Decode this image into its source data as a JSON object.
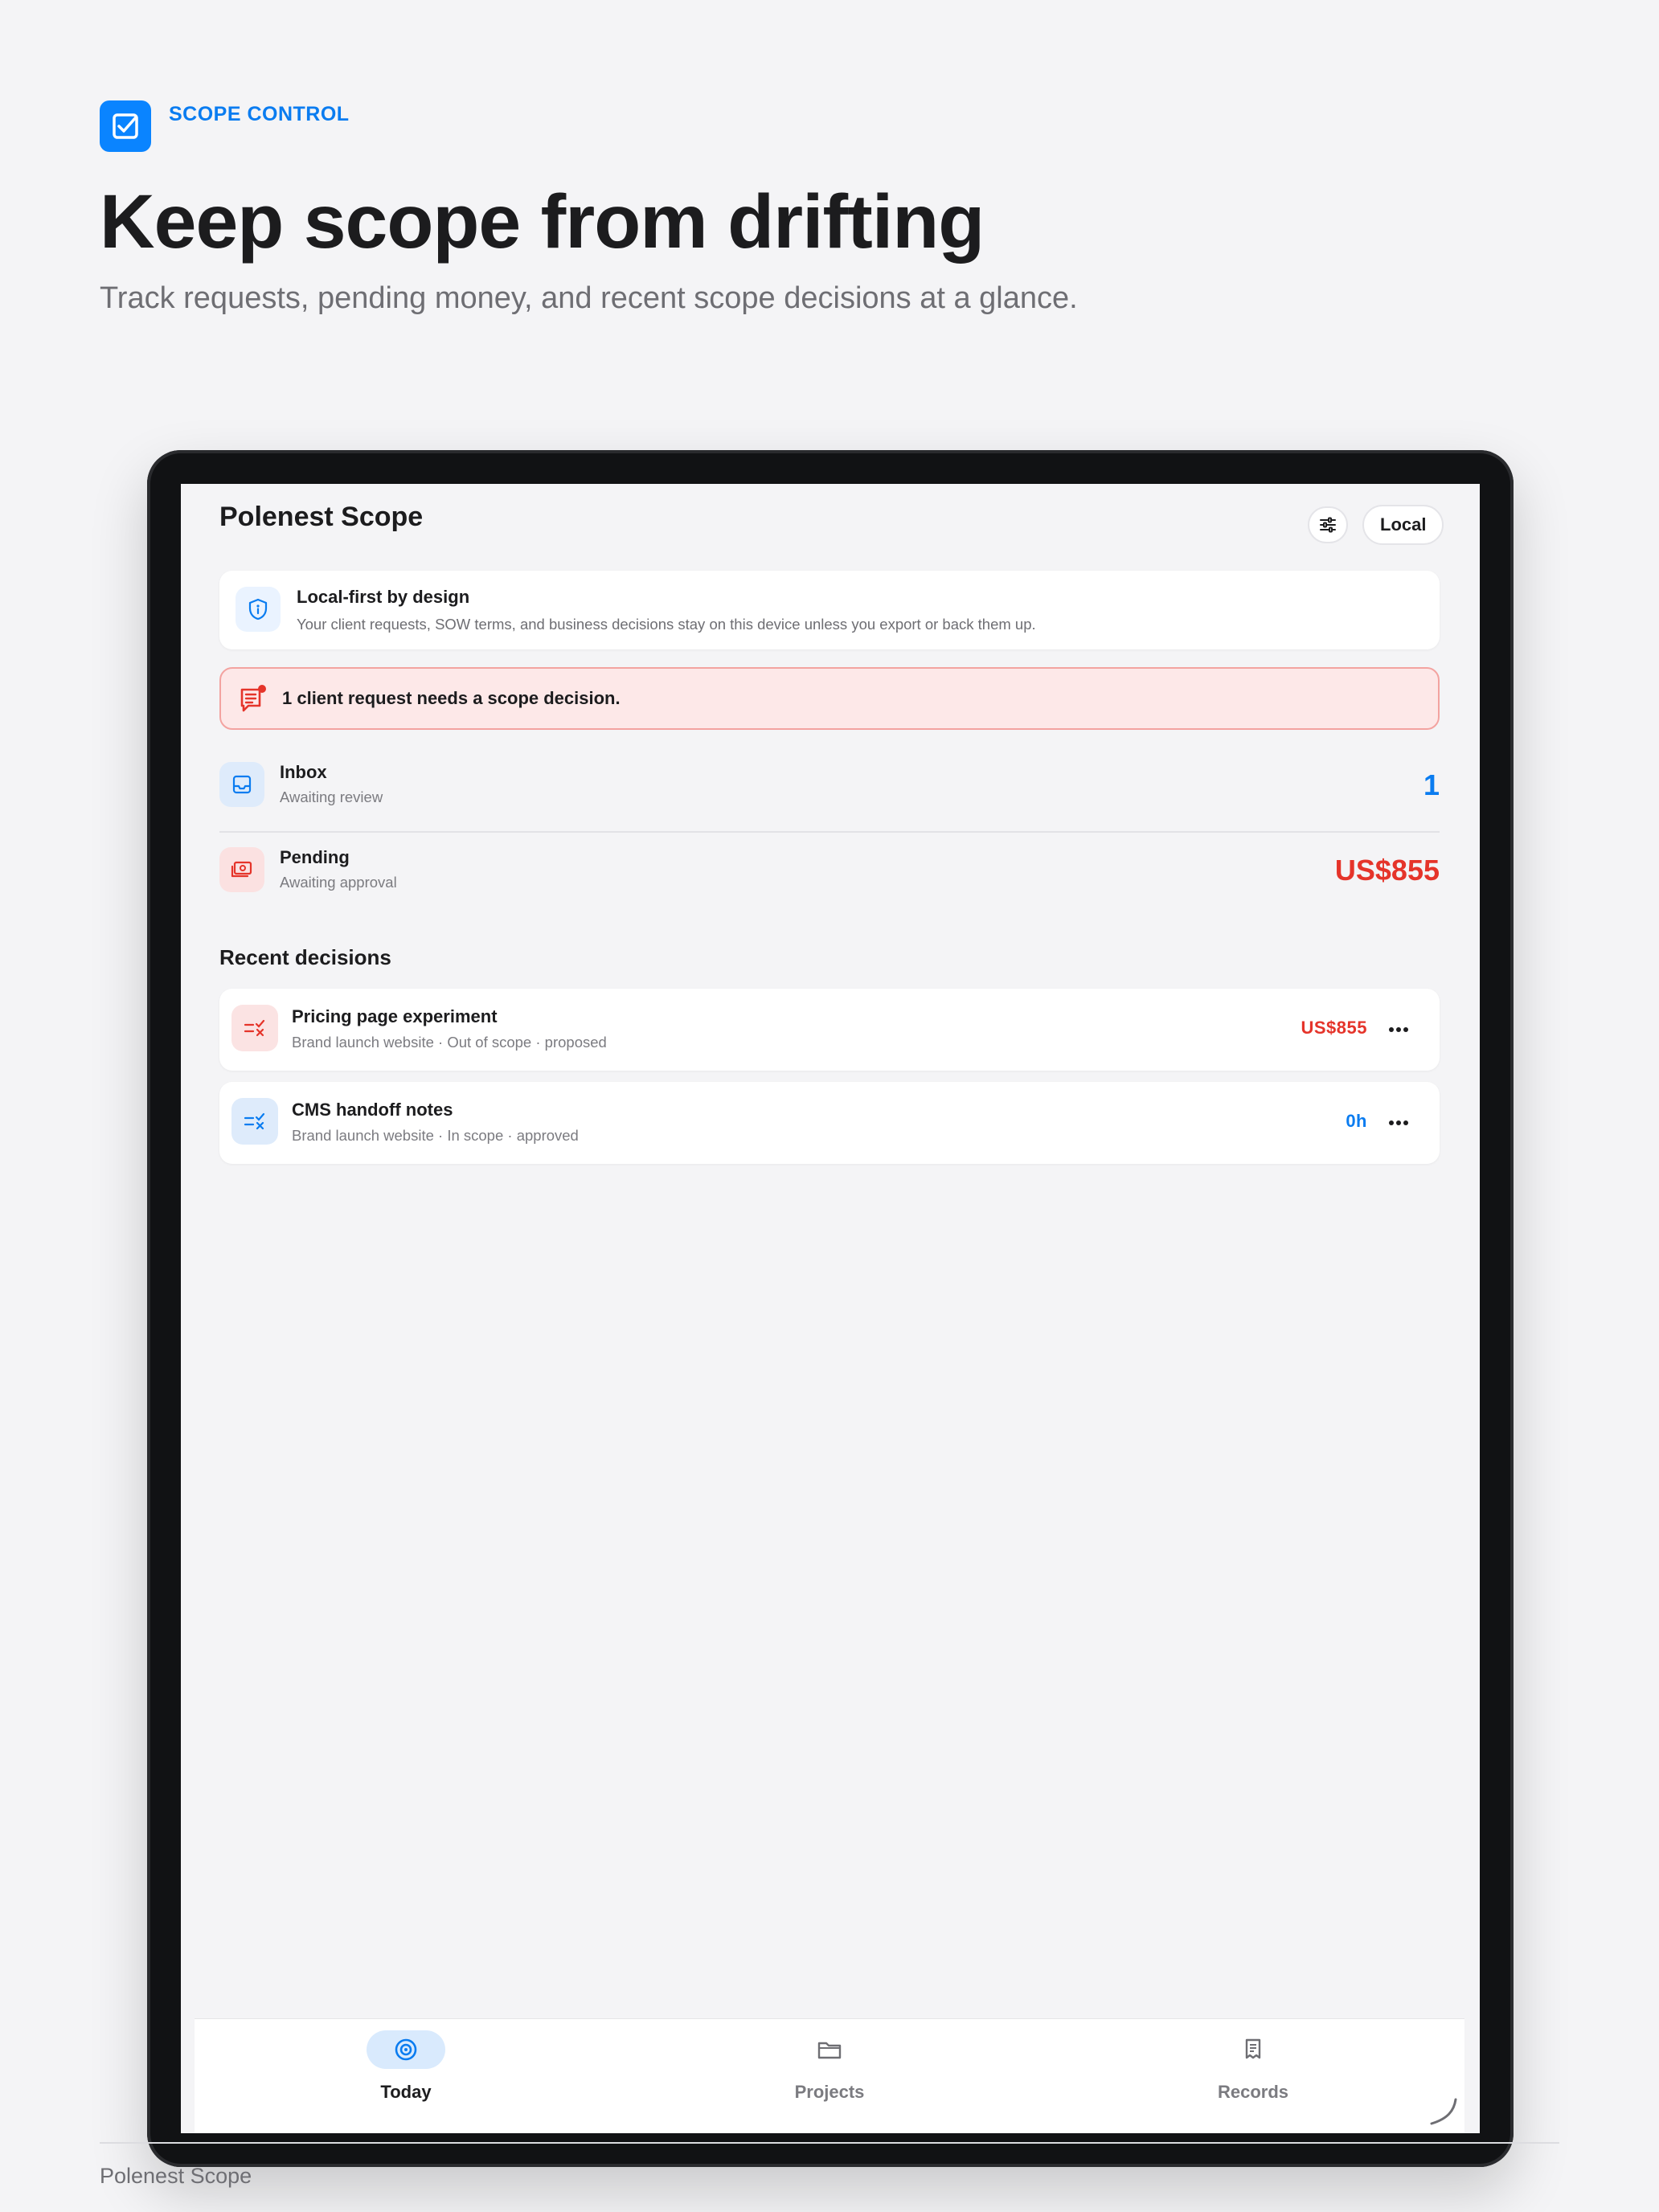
{
  "hero": {
    "eyebrow": "SCOPE CONTROL",
    "title": "Keep scope from drifting",
    "subtitle": "Track requests, pending money, and recent scope decisions at a glance.",
    "icon": "checkbox-icon"
  },
  "app": {
    "title": "Polenest Scope",
    "filter_icon": "sliders-icon",
    "storage_label": "Local"
  },
  "privacy_card": {
    "title": "Local-first by design",
    "body": "Your client requests, SOW terms, and business decisions stay on this device unless you export or back them up.",
    "icon": "shield-icon"
  },
  "alert": {
    "text": "1 client request needs a scope decision.",
    "icon": "message-alert-icon"
  },
  "stats": [
    {
      "label": "Inbox",
      "sublabel": "Awaiting review",
      "value": "1",
      "color": "#0a7cf0",
      "icon": "inbox-icon"
    },
    {
      "label": "Pending",
      "sublabel": "Awaiting approval",
      "value": "US$855",
      "color": "#e5342a",
      "icon": "money-icon"
    }
  ],
  "recent": {
    "title": "Recent decisions",
    "items": [
      {
        "title": "Pricing page experiment",
        "meta": "Brand launch website · Out of scope · proposed",
        "value": "US$855",
        "color": "#e5342a",
        "icon": "scope-check-icon"
      },
      {
        "title": "CMS handoff notes",
        "meta": "Brand launch website · In scope · approved",
        "value": "0h",
        "color": "#0a7cf0",
        "icon": "scope-check-icon"
      }
    ]
  },
  "tabs": [
    {
      "label": "Today",
      "icon": "today-icon",
      "active": true
    },
    {
      "label": "Projects",
      "icon": "folder-icon",
      "active": false
    },
    {
      "label": "Records",
      "icon": "receipt-icon",
      "active": false
    }
  ],
  "footer": {
    "brand": "Polenest Scope"
  },
  "colors": {
    "accent": "#0a84ff",
    "danger": "#e5342a",
    "background": "#f4f4f6"
  }
}
